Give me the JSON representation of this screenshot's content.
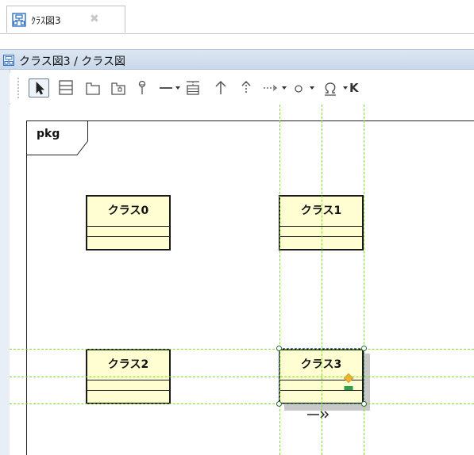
{
  "tab": {
    "label": "ｸﾗｽ図3",
    "close": "✖",
    "icon": "class-diagram-icon"
  },
  "titlebar": {
    "label": "クラス図3 / クラス図",
    "icon": "diagram-icon"
  },
  "toolbar": {
    "tools": [
      {
        "name": "select-tool",
        "icon": "cursor-arrow-icon"
      },
      {
        "name": "class-tool",
        "icon": "class-icon"
      },
      {
        "name": "package-tool",
        "icon": "package-icon"
      },
      {
        "name": "subsystem-tool",
        "icon": "model-package-icon"
      },
      {
        "name": "interface-tool",
        "icon": "lollipop-icon"
      },
      {
        "name": "association-tool",
        "icon": "association-line-icon"
      },
      {
        "name": "association-dropdown",
        "icon": "dropdown-arrow-icon"
      },
      {
        "name": "association-class-tool",
        "icon": "association-class-icon"
      },
      {
        "name": "generalization-tool",
        "icon": "generalization-arrow-icon"
      },
      {
        "name": "realization-tool",
        "icon": "realization-arrow-icon"
      },
      {
        "name": "dependency-tool",
        "icon": "dependency-arrow-icon"
      },
      {
        "name": "dependency-dropdown",
        "icon": "dropdown-arrow-icon"
      },
      {
        "name": "note-anchor-tool",
        "icon": "circle-icon"
      },
      {
        "name": "note-dropdown",
        "icon": "dropdown-arrow-icon"
      },
      {
        "name": "omega-tool",
        "icon": "omega-icon"
      },
      {
        "name": "omega-dropdown",
        "icon": "dropdown-arrow-icon"
      }
    ],
    "overflow_label": "K"
  },
  "diagram": {
    "package_label": "pkg",
    "classes": [
      {
        "id": "class0",
        "name": "クラス0"
      },
      {
        "id": "class1",
        "name": "クラス1"
      },
      {
        "id": "class2",
        "name": "クラス2"
      },
      {
        "id": "class3",
        "name": "クラス3",
        "selected": true
      }
    ],
    "guides_color": "#7fe01e",
    "class_fill": "#fffed2"
  },
  "colors": {
    "titlebar": "#d4e0ee",
    "accent": "#2f6fbf"
  }
}
